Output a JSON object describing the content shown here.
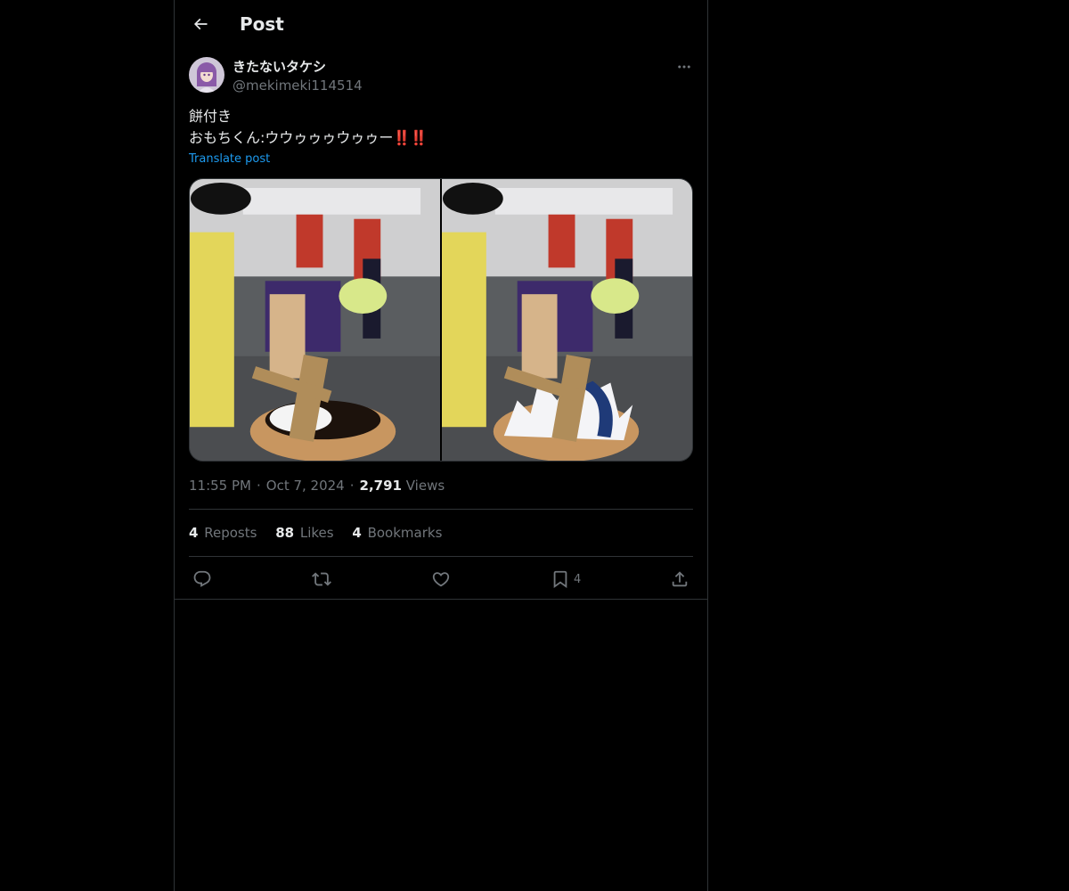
{
  "header": {
    "title": "Post",
    "back_icon": "arrow-left-icon"
  },
  "author": {
    "name": "きたないタケシ",
    "handle": "@mekimeki114514",
    "more_icon": "more-horizontal-icon"
  },
  "post": {
    "line1": "餅付き",
    "line2": "おもちくん:ウウゥゥゥウゥゥー",
    "line2_emoji": "‼️‼️",
    "translate_label": "Translate post",
    "images": [
      "mochi-pounding-photo",
      "mochi-pounding-photo-edited"
    ]
  },
  "meta": {
    "time": "11:55 PM",
    "date": "Oct 7, 2024",
    "views_count": "2,791",
    "views_label": "Views"
  },
  "stats": {
    "reposts_count": "4",
    "reposts_label": "Reposts",
    "likes_count": "88",
    "likes_label": "Likes",
    "bookmarks_count": "4",
    "bookmarks_label": "Bookmarks"
  },
  "actions": {
    "reply_icon": "reply-icon",
    "repost_icon": "repost-icon",
    "like_icon": "heart-icon",
    "bookmark_icon": "bookmark-icon",
    "bookmark_count": "4",
    "share_icon": "share-icon"
  },
  "colors": {
    "background": "#000000",
    "text": "#e7e9ea",
    "secondary_text": "#71767b",
    "link": "#1d9bf0",
    "border": "#2f3336"
  }
}
